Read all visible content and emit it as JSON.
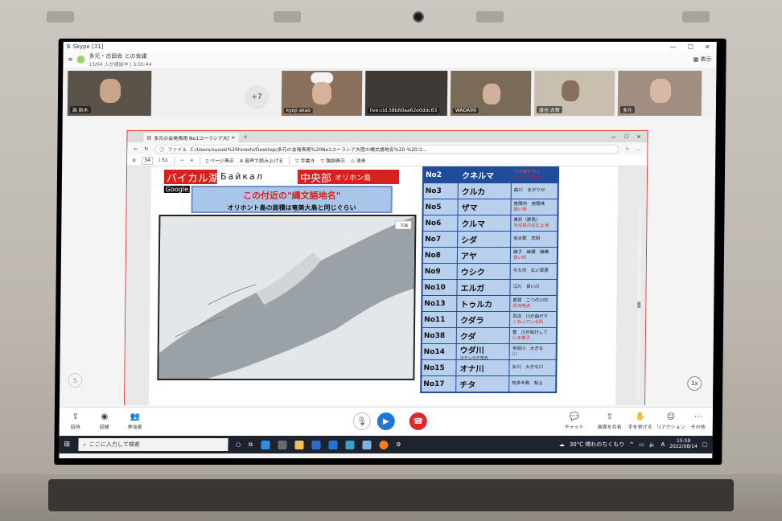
{
  "skype": {
    "title": "Skype [31]",
    "call_name": "多元・古田会 との会議",
    "call_sub": "13/64 人が通話中 | 3:05:44",
    "display_label": "表示",
    "more_count": "+7",
    "participants": [
      "高 鈴木",
      "kyoji akao",
      "live:cid.58b60aa62e0ddc63",
      "WADA99",
      "渡也 古賀",
      "多元"
    ],
    "left_buttons": [
      "招待",
      "収録",
      "参加者"
    ],
    "right_buttons": [
      "チャット",
      "画面を共有",
      "手を挙げる",
      "リアクション",
      "その他"
    ],
    "zoom_badge": "1x"
  },
  "edge": {
    "tab_title": "多元の会発表用 No1ユーラシア大陸",
    "new_tab": "+",
    "url_label": "ファイル",
    "url": "C:/Users/suzuki%20hiroshi/Desktop/多元の会発表用%20No1ユーラシア大陸の縄文語地名%20-%20コ...",
    "page_num": "34",
    "page_total": "/ 51",
    "toolbar": [
      "ページ表示",
      "音声で読み上げる",
      "手書き",
      "強調表示",
      "消去"
    ]
  },
  "slide": {
    "hdr1": "バイカル湖",
    "cyrillic": "Байкал",
    "hdr2": "中央部",
    "hdr2_sub": "オリホン島",
    "google": "Google",
    "banner1": "この付近の\"縄文語地名\"",
    "banner2": "オリホント島の面積は奄美大島と同じぐらい",
    "map_label": "写真"
  },
  "table": [
    {
      "no": "No2",
      "name": "クネルマ",
      "sub": "",
      "desc1": "川が曲がりく",
      "desc2": "ねっている所"
    },
    {
      "no": "No3",
      "name": "クルカ",
      "sub": "",
      "desc1": "曲川　まがりか",
      "desc2": ""
    },
    {
      "no": "No5",
      "name": "ザマ",
      "sub": "",
      "desc1": "座間市　座間味",
      "desc2": "狭い所"
    },
    {
      "no": "No6",
      "name": "クルマ",
      "sub": "",
      "desc1": "車折（群馬）",
      "desc2": "先住民の住む土地"
    },
    {
      "no": "No7",
      "name": "シダ",
      "sub": "",
      "desc1": "信太郡　志田",
      "desc2": ""
    },
    {
      "no": "No8",
      "name": "アヤ",
      "sub": "",
      "desc1": "綾子　綾瀬　綾織",
      "desc2": "良い所"
    },
    {
      "no": "No9",
      "name": "ウシク",
      "sub": "",
      "desc1": "牛久市　広い草原",
      "desc2": ""
    },
    {
      "no": "No10",
      "name": "エルガ",
      "sub": "",
      "desc1": "江川　良い川",
      "desc2": ""
    },
    {
      "no": "No13",
      "name": "トゥルカ",
      "sub": "",
      "desc1": "敦賀　二つの川の",
      "desc2": "合流地点"
    },
    {
      "no": "No11",
      "name": "クダラ",
      "sub": "",
      "desc1": "百済　川が曲がり",
      "desc2": "くねっている所"
    },
    {
      "no": "No38",
      "name": "クダ",
      "sub": "",
      "desc1": "菅　川が蛇行して",
      "desc2": "いる様子"
    },
    {
      "no": "No14",
      "name": "ウダ川",
      "sub": "ウランウデ市内",
      "desc1": "宇田川　大きな",
      "desc2": "川"
    },
    {
      "no": "No15",
      "name": "オナ川",
      "sub": "",
      "desc1": "女川　大きな川",
      "desc2": ""
    },
    {
      "no": "No17",
      "name": "チタ",
      "sub": "",
      "desc1": "知多半島　粘土",
      "desc2": ""
    }
  ],
  "taskbar": {
    "search_placeholder": "ここに入力して検索",
    "weather": "30°C 晴れのちくもり",
    "ime": "A",
    "time": "15:59",
    "date": "2022/08/14"
  },
  "colors": {
    "skype_blue": "#1d79d8",
    "hangup_red": "#e0282c",
    "slide_red": "#d8211d",
    "table_blue": "#1f4c9c",
    "table_cell": "#b8d0ee"
  }
}
